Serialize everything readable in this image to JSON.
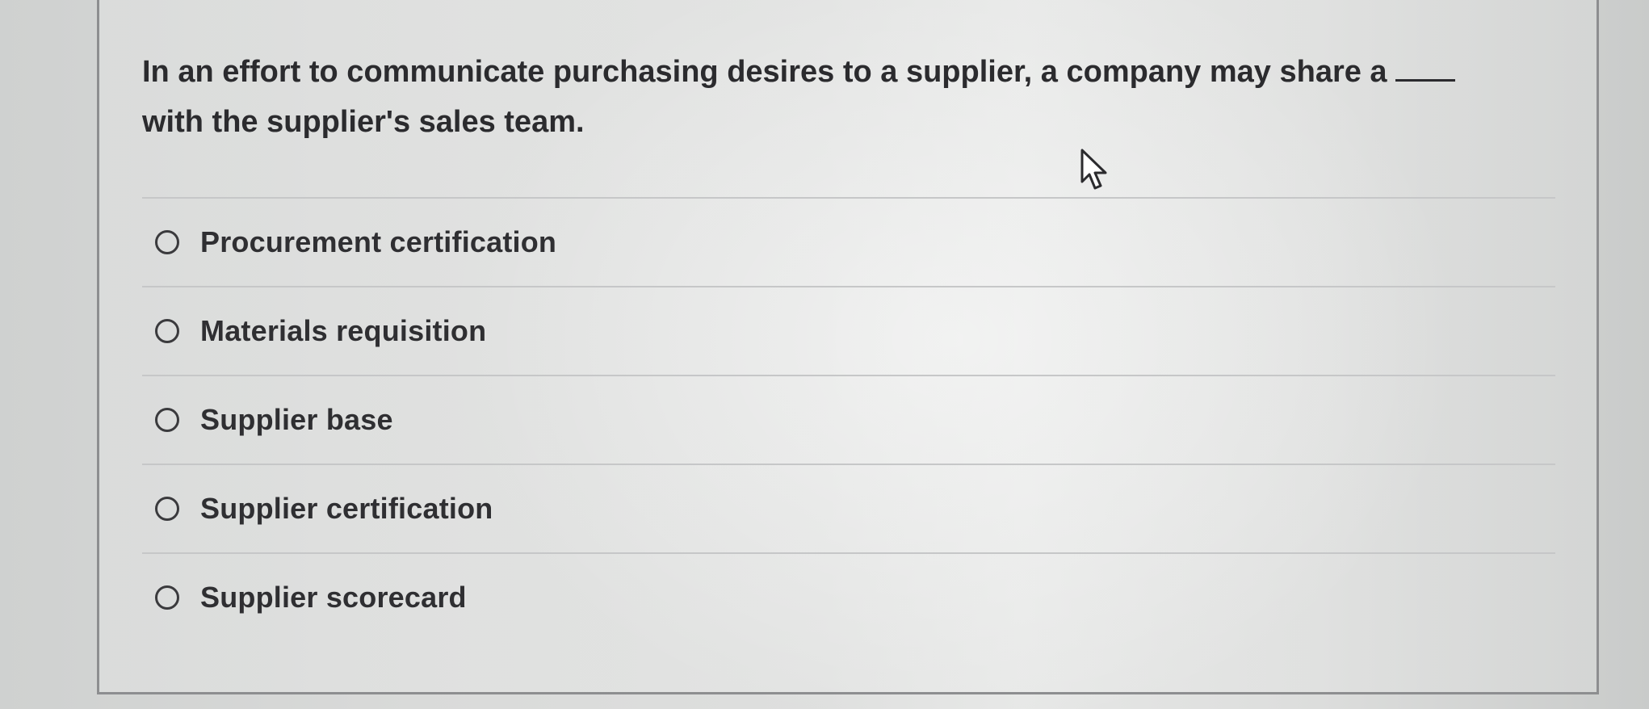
{
  "question": {
    "text": "In an effort to communicate purchasing desires to a supplier, a company may share a",
    "text_after_blank": "with the supplier's sales team."
  },
  "options": [
    {
      "label": "Procurement certification",
      "selected": false
    },
    {
      "label": "Materials requisition",
      "selected": false
    },
    {
      "label": "Supplier base",
      "selected": false
    },
    {
      "label": "Supplier certification",
      "selected": false
    },
    {
      "label": "Supplier scorecard",
      "selected": false
    }
  ],
  "icons": {
    "cursor": "mouse-pointer-icon",
    "radio": "radio-unchecked-icon"
  },
  "colors": {
    "text": "#2b2b2e",
    "border": "#8d8e90",
    "separator": "#c6c7c8"
  }
}
